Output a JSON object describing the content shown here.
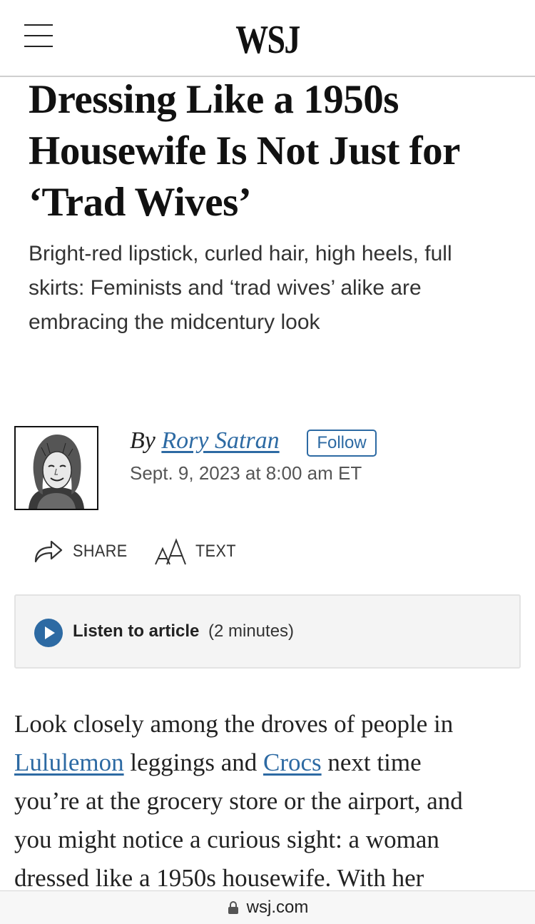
{
  "header": {
    "logo": "WSJ",
    "menu_icon": "hamburger-menu-icon"
  },
  "article": {
    "headline_lines": [
      "Dressing Like a 1950s",
      "Housewife Is Not Just for",
      "‘Trad Wives’"
    ],
    "dek_lines": [
      "Bright-red lipstick, curled hair, high heels, full",
      "skirts: Feminists and ‘trad wives’ alike are",
      "embracing the midcentury look"
    ],
    "byline_prefix": "By ",
    "author": "Rory Satran",
    "follow_label": "Follow",
    "timestamp": "Sept. 9, 2023 at 8:00 am ET",
    "author_photo": "author-headshot-illustration"
  },
  "tools": {
    "share_label": "SHARE",
    "share_icon": "share-arrow-icon",
    "text_label": "TEXT",
    "text_icon": "text-size-icon"
  },
  "listen": {
    "label": "Listen to article",
    "duration": "(2 minutes)",
    "icon": "play-icon"
  },
  "body": {
    "line1": "Look closely among the droves of people in",
    "link1": "Lululemon",
    "line2_mid": " leggings and ",
    "link2": "Crocs",
    "line2_end": " next time",
    "line3": "you’re at the grocery store or the airport, and",
    "line4": "you might notice a curious sight: a woman",
    "line5": "dressed like a 1950s housewife. With her"
  },
  "browser": {
    "url": "wsj.com",
    "lock_icon": "lock-icon"
  },
  "colors": {
    "link": "#2d6aa3",
    "listen_bg": "#f4f4f4"
  }
}
